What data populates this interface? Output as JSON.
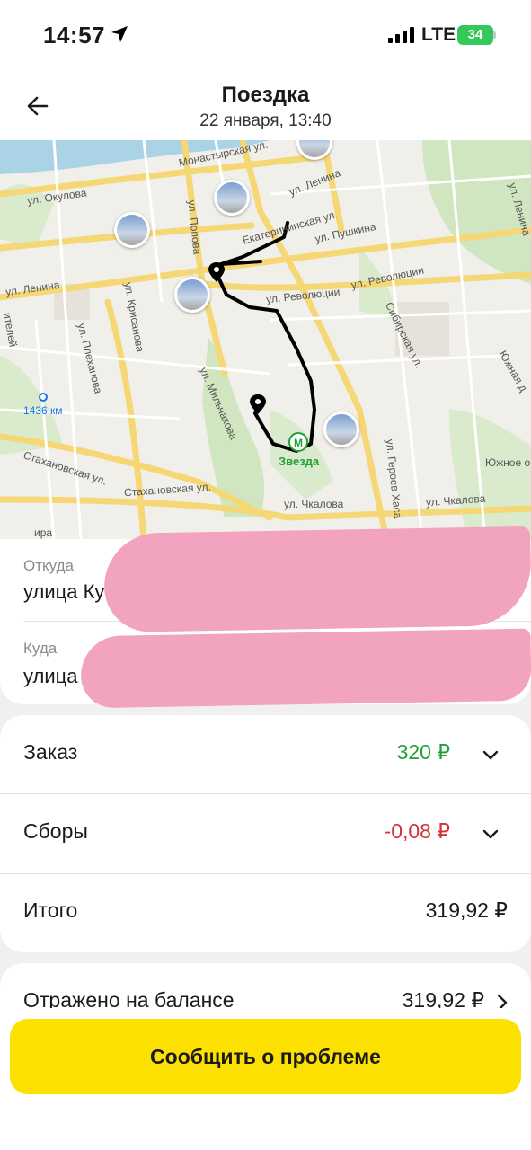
{
  "status_bar": {
    "time": "14:57",
    "network": "LTE",
    "battery": "34"
  },
  "header": {
    "title": "Поездка",
    "subtitle": "22 января, 13:40"
  },
  "map": {
    "labels": {
      "monastyrskaya": "Монастырская ул.",
      "okulova": "ул. Окулова",
      "lenina_top": "ул. Ленина",
      "lenina_left": "ул. Ленина",
      "ekaterininskaya": "Екатерининская ул.",
      "pushkina": "ул. Пушкина",
      "popova": "ул. Попова",
      "revolyutsii_1": "ул. Революции",
      "revolyutsii_2": "ул. Революции",
      "sibirskaya": "Сибирская ул.",
      "krisanova": "ул. Крисанова",
      "plekhanova": "ул. Плеханова",
      "telei": "ителей",
      "km": "1436 км",
      "melnikova": "ул. Мильчакова",
      "stakhanovskaya_1": "Стахановская ул.",
      "stakhanovskaya_2": "Стахановская ул.",
      "chkalova_1": "ул. Чкалова",
      "chkalova_2": "ул. Чкалова",
      "geroev": "ул. Героев Хаса",
      "yuzhnaya": "Южная д",
      "yuzhnoe": "Южное о",
      "zvezda": "Звезда",
      "lenina_right": "ул. Ленина",
      "ira": "ира"
    }
  },
  "addresses": {
    "from_label": "Откуда",
    "from_value": "улица Ку",
    "to_label": "Куда",
    "to_value": "улица"
  },
  "price": {
    "order_label": "Заказ",
    "order_value": "320 ₽",
    "fees_label": "Сборы",
    "fees_value": "-0,08 ₽",
    "total_label": "Итого",
    "total_value": "319,92 ₽",
    "colors": {
      "order": "#21a038",
      "fees": "#d13438"
    }
  },
  "balance": {
    "label": "Отражено на балансе",
    "value": "319,92 ₽"
  },
  "actions": {
    "report_label": "Сообщить о проблеме"
  },
  "icons": {
    "back": "arrow-left-icon",
    "location": "location-arrow-icon",
    "chevron": "chevron-down-icon",
    "chevron_right": "chevron-right-icon"
  }
}
